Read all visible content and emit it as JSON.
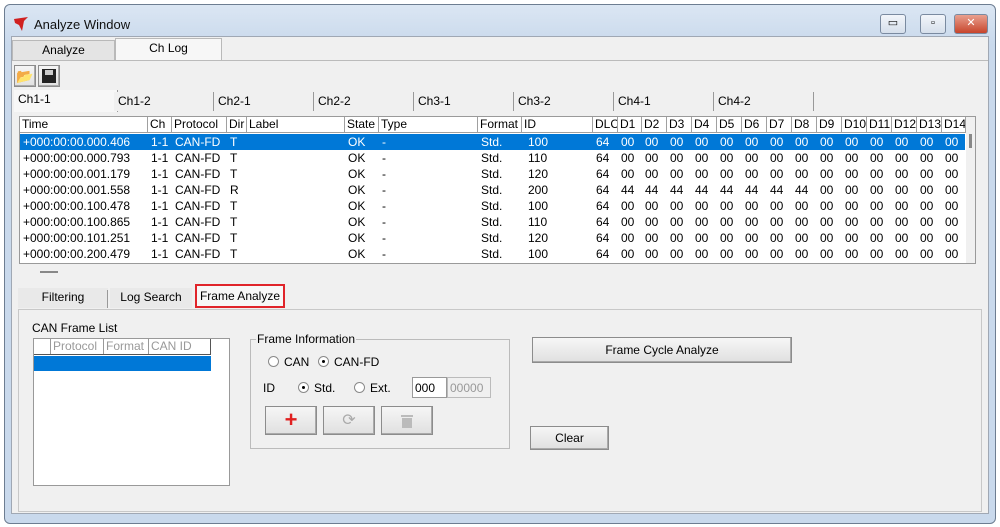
{
  "window": {
    "title": "Analyze Window",
    "min": "▭",
    "max": "▫",
    "close": "✕"
  },
  "main_tabs": [
    "Analyze",
    "Ch Log"
  ],
  "channel_tabs": [
    "Ch1-1",
    "Ch1-2",
    "Ch2-1",
    "Ch2-2",
    "Ch3-1",
    "Ch3-2",
    "Ch4-1",
    "Ch4-2"
  ],
  "log_table": {
    "columns": [
      "Time",
      "Ch",
      "Protocol",
      "Dir",
      "Label",
      "State",
      "Type",
      "Format",
      "ID",
      "DLC",
      "D1",
      "D2",
      "D3",
      "D4",
      "D5",
      "D6",
      "D7",
      "D8",
      "D9",
      "D10",
      "D11",
      "D12",
      "D13",
      "D14"
    ],
    "rows": [
      [
        "+000:00:00.000.406",
        "1-1",
        "CAN-FD",
        "T",
        "",
        "OK",
        "-",
        "Std.",
        "100",
        "64",
        "00",
        "00",
        "00",
        "00",
        "00",
        "00",
        "00",
        "00",
        "00",
        "00",
        "00",
        "00",
        "00",
        "00"
      ],
      [
        "+000:00:00.000.793",
        "1-1",
        "CAN-FD",
        "T",
        "",
        "OK",
        "-",
        "Std.",
        "110",
        "64",
        "00",
        "00",
        "00",
        "00",
        "00",
        "00",
        "00",
        "00",
        "00",
        "00",
        "00",
        "00",
        "00",
        "00"
      ],
      [
        "+000:00:00.001.179",
        "1-1",
        "CAN-FD",
        "T",
        "",
        "OK",
        "-",
        "Std.",
        "120",
        "64",
        "00",
        "00",
        "00",
        "00",
        "00",
        "00",
        "00",
        "00",
        "00",
        "00",
        "00",
        "00",
        "00",
        "00"
      ],
      [
        "+000:00:00.001.558",
        "1-1",
        "CAN-FD",
        "R",
        "",
        "OK",
        "-",
        "Std.",
        "200",
        "64",
        "44",
        "44",
        "44",
        "44",
        "44",
        "44",
        "44",
        "44",
        "00",
        "00",
        "00",
        "00",
        "00",
        "00"
      ],
      [
        "+000:00:00.100.478",
        "1-1",
        "CAN-FD",
        "T",
        "",
        "OK",
        "-",
        "Std.",
        "100",
        "64",
        "00",
        "00",
        "00",
        "00",
        "00",
        "00",
        "00",
        "00",
        "00",
        "00",
        "00",
        "00",
        "00",
        "00"
      ],
      [
        "+000:00:00.100.865",
        "1-1",
        "CAN-FD",
        "T",
        "",
        "OK",
        "-",
        "Std.",
        "110",
        "64",
        "00",
        "00",
        "00",
        "00",
        "00",
        "00",
        "00",
        "00",
        "00",
        "00",
        "00",
        "00",
        "00",
        "00"
      ],
      [
        "+000:00:00.101.251",
        "1-1",
        "CAN-FD",
        "T",
        "",
        "OK",
        "-",
        "Std.",
        "120",
        "64",
        "00",
        "00",
        "00",
        "00",
        "00",
        "00",
        "00",
        "00",
        "00",
        "00",
        "00",
        "00",
        "00",
        "00"
      ],
      [
        "+000:00:00.200.479",
        "1-1",
        "CAN-FD",
        "T",
        "",
        "OK",
        "-",
        "Std.",
        "100",
        "64",
        "00",
        "00",
        "00",
        "00",
        "00",
        "00",
        "00",
        "00",
        "00",
        "00",
        "00",
        "00",
        "00",
        "00"
      ]
    ],
    "selected_row": 0
  },
  "lower_tabs": [
    "Filtering",
    "Log Search",
    "Frame Analyze"
  ],
  "frame_analyze": {
    "list_label": "CAN Frame List",
    "list_columns": [
      "Protocol",
      "Format",
      "CAN ID"
    ],
    "group_label": "Frame Information",
    "radio_can": "CAN",
    "radio_canfd": "CAN-FD",
    "protocol_selected": "CAN-FD",
    "id_label": "ID",
    "radio_std": "Std.",
    "radio_ext": "Ext.",
    "format_selected": "Std.",
    "id_value": "000",
    "id_ext_value": "00000",
    "cycle_button": "Frame Cycle Analyze",
    "clear_button": "Clear"
  }
}
